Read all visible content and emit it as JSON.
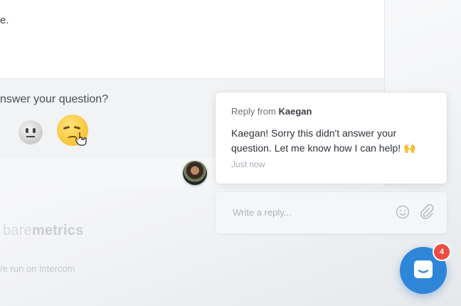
{
  "article": {
    "fragment_text": "e.",
    "feedback_question": "nswer your question?",
    "reactions": [
      "neutral-face",
      "disappointed-face"
    ]
  },
  "footer": {
    "brand_light": "bare",
    "brand_bold": "metrics",
    "powered_by": "/e run on Intercom"
  },
  "message": {
    "from_prefix": "Reply from ",
    "sender": "Kaegan",
    "body": "Kaegan! Sorry this didn't answer your question. Let me know how I can help! 🙌",
    "time": "Just now"
  },
  "reply": {
    "placeholder": "Write a reply..."
  },
  "launcher": {
    "badge_count": "4",
    "accent_color": "#2f86d8",
    "badge_color": "#ee4b44"
  },
  "icons": [
    "neutral-face-icon",
    "disappointed-face-icon",
    "pointer-hand-icon",
    "avatar",
    "emoji-icon",
    "attachment-icon",
    "chat-icon"
  ]
}
